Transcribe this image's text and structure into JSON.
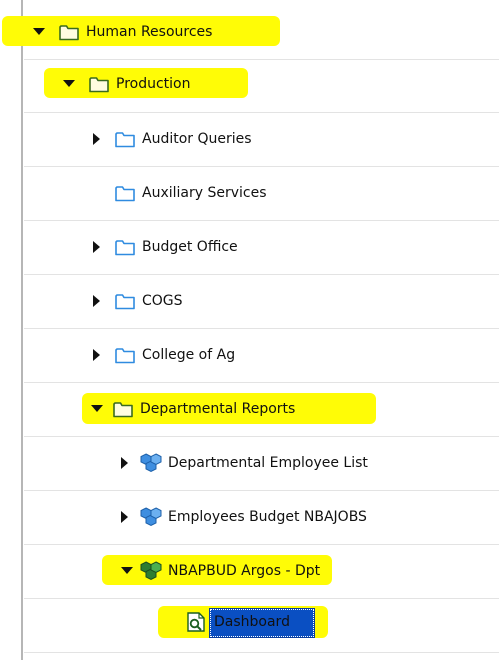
{
  "tree": {
    "human_resources": "Human Resources",
    "production": "Production",
    "auditor_queries": "Auditor Queries",
    "auxiliary_services": "Auxiliary Services",
    "budget_office": "Budget Office",
    "cogs": "COGS",
    "college_of_ag": "College of Ag",
    "departmental_reports": "Departmental Reports",
    "departmental_employee_list": "Departmental Employee List",
    "employees_budget": "Employees Budget NBAJOBS",
    "nbapbud_argos": "NBAPBUD Argos - Dpt",
    "dashboard": "Dashboard"
  },
  "icons": {
    "folder": "folder-icon",
    "datablock": "datablock-icon",
    "report": "dashboard-report-icon",
    "expanded": "chevron-down-icon",
    "collapsed": "chevron-right-icon"
  },
  "colors": {
    "highlight": "#fffc06",
    "folder_stroke": "#2f8be0",
    "folder_yellow_stroke": "#3a6b1f",
    "selection": "#0a4fc2"
  }
}
